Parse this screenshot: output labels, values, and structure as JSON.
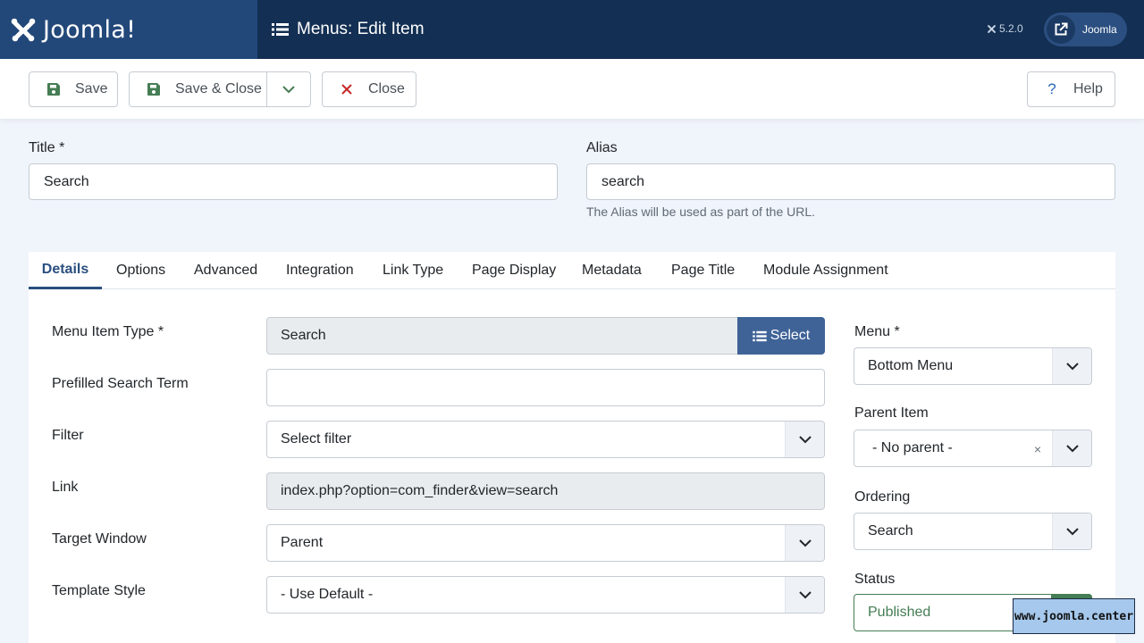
{
  "header": {
    "logo_text": "Joomla!",
    "title": "Menus: Edit Item",
    "version": "5.2.0",
    "user_label": "Joomla"
  },
  "toolbar": {
    "save_label": "Save",
    "save_close_label": "Save & Close",
    "close_label": "Close",
    "help_label": "Help"
  },
  "form": {
    "title_label": "Title *",
    "title_value": "Search",
    "alias_label": "Alias",
    "alias_value": "search",
    "alias_hint": "The Alias will be used as part of the URL."
  },
  "tabs": [
    {
      "label": "Details"
    },
    {
      "label": "Options"
    },
    {
      "label": "Advanced"
    },
    {
      "label": "Integration"
    },
    {
      "label": "Link Type"
    },
    {
      "label": "Page Display"
    },
    {
      "label": "Metadata"
    },
    {
      "label": "Page Title"
    },
    {
      "label": "Module Assignment"
    }
  ],
  "details": {
    "menu_item_type_label": "Menu Item Type *",
    "menu_item_type_value": "Search",
    "select_label": "Select",
    "prefilled_label": "Prefilled Search Term",
    "prefilled_value": "",
    "filter_label": "Filter",
    "filter_value": "Select filter",
    "link_label": "Link",
    "link_value": "index.php?option=com_finder&view=search",
    "target_label": "Target Window",
    "target_value": "Parent",
    "template_label": "Template Style",
    "template_value": "- Use Default -"
  },
  "sidebar": {
    "menu_label": "Menu *",
    "menu_value": "Bottom Menu",
    "parent_label": "Parent Item",
    "parent_value": "- No parent -",
    "clear_symbol": "×",
    "ordering_label": "Ordering",
    "ordering_value": "Search",
    "status_label": "Status",
    "status_value": "Published"
  },
  "watermark": "www.joomla.center",
  "colors": {
    "header_bg": "#132f53",
    "logo_bg": "#22487a",
    "accent": "#2a4f80",
    "select_button": "#3f6397",
    "published": "#457d54",
    "close_icon": "#c52827"
  }
}
